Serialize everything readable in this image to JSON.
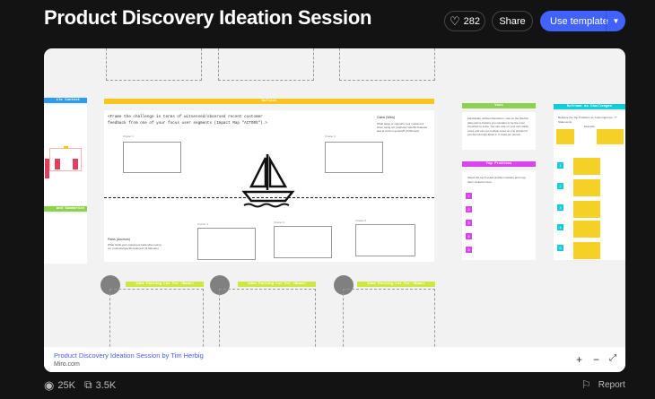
{
  "header": {
    "title": "Product Discovery Ideation Session",
    "likes": "282",
    "share_label": "Share",
    "use_template_label": "Use template"
  },
  "board": {
    "left_context_header": "ile Context",
    "left_summarize_header": "and Summarize",
    "reflect_header": "Reflect",
    "reflect_prompt_line1": "<Frame the challenge in terms of witnessed/observed recent customer",
    "reflect_prompt_line2": "feedback from one of your focus user segments (Impact Map \"ACTORS\").>",
    "gains_title": "Gains (Wins)",
    "gains_text": "What helps or supports your customers when using our products/ specific features and at work in general? (3 Minutes)",
    "pains_title": "Pains (Anchors)",
    "pains_text": "What holds your customers back when using our products/specific features? (3 Minutes)",
    "clusters": [
      "Cluster 1",
      "Cluster 2",
      "Cluster 3",
      "Cluster 4",
      "Cluster 5"
    ],
    "vote_header": "Vote",
    "vote_text": "Individually, without discussion, vote on the thecher (aka pains) clusters you consider to be the most important to solve. You can vote on your own sticky notes and can put multiple votes on one problem if you feel strongly about it. 3 votes per person.",
    "top_problems_header": "Top Problems",
    "top_problems_text": "Select the top 5 voted problem clusters and copy them ranked in here.",
    "numbers": [
      "1",
      "2",
      "3",
      "4",
      "5"
    ],
    "reframe_header": "Reframe as Challenges",
    "reframe_text": "Reframe the Top Problems as \"How might we...?\" Statements",
    "example_label": "Example",
    "parking_lot_label": "Idea Parking Lot for <Name>",
    "colors": {
      "reflect": "#f8c51c",
      "vote": "#8fd14f",
      "top_problems": "#da44f0",
      "reframe": "#12cdd4",
      "parking": "#cee741",
      "context": "#2d9bf0",
      "sticky": "#f5d027"
    }
  },
  "footer": {
    "link": "Product Discovery Ideation Session by Tim Herbig",
    "site": "Miro.com"
  },
  "stats": {
    "views": "25K",
    "copies": "3.5K",
    "report_label": "Report"
  }
}
